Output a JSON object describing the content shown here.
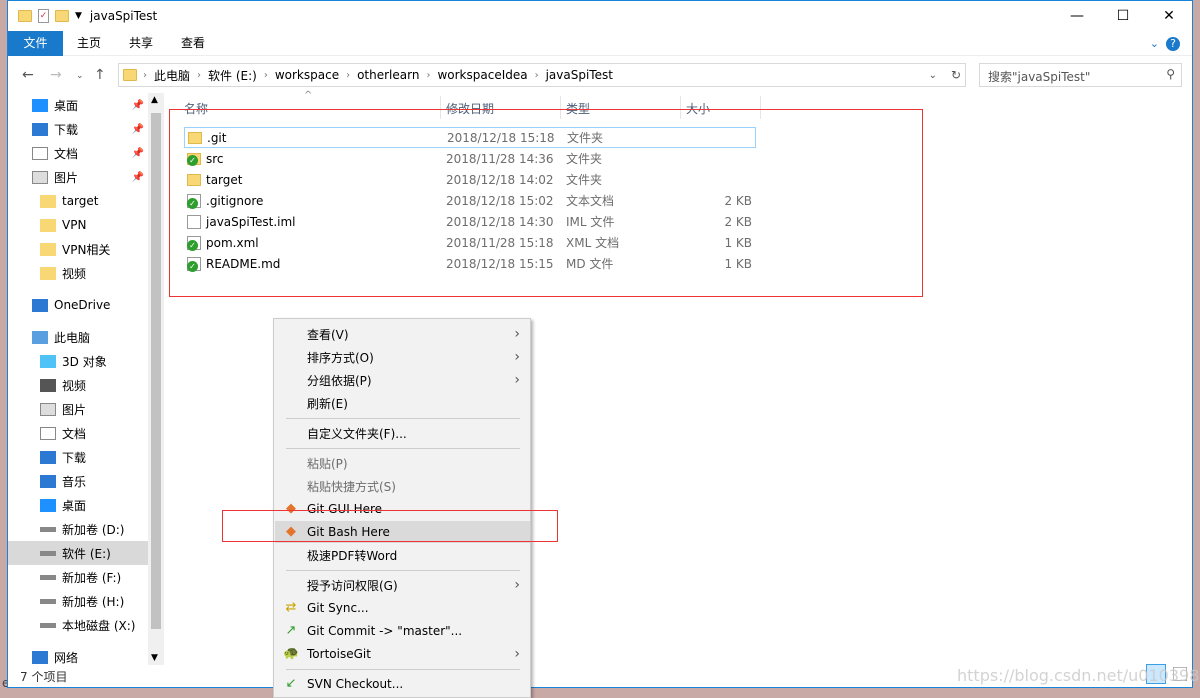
{
  "window": {
    "title": "javaSpiTest",
    "minimize": "—",
    "maximize": "☐",
    "close": "✕"
  },
  "ribbon": {
    "tabs": [
      "文件",
      "主页",
      "共享",
      "查看"
    ],
    "expand": "⌄",
    "help": "?"
  },
  "address": {
    "crumbs": [
      "此电脑",
      "软件 (E:)",
      "workspace",
      "otherlearn",
      "workspaceIdea",
      "javaSpiTest"
    ],
    "search_placeholder": "搜索\"javaSpiTest\""
  },
  "nav": {
    "items": [
      {
        "label": "桌面",
        "icon": "desktop-icon",
        "pinned": true
      },
      {
        "label": "下载",
        "icon": "download-icon",
        "pinned": true
      },
      {
        "label": "文档",
        "icon": "document-icon",
        "pinned": true
      },
      {
        "label": "图片",
        "icon": "picture-icon",
        "pinned": true
      },
      {
        "label": "target",
        "icon": "folder-icon"
      },
      {
        "label": "VPN",
        "icon": "folder-icon"
      },
      {
        "label": "VPN相关",
        "icon": "folder-icon"
      },
      {
        "label": "视频",
        "icon": "folder-icon"
      },
      {
        "label": "OneDrive",
        "icon": "cloud-icon"
      },
      {
        "label": "此电脑",
        "icon": "computer-icon"
      },
      {
        "label": "3D 对象",
        "icon": "cube-icon"
      },
      {
        "label": "视频",
        "icon": "video-icon"
      },
      {
        "label": "图片",
        "icon": "picture-icon"
      },
      {
        "label": "文档",
        "icon": "document-icon"
      },
      {
        "label": "下载",
        "icon": "download-icon"
      },
      {
        "label": "音乐",
        "icon": "music-icon"
      },
      {
        "label": "桌面",
        "icon": "desktop-icon"
      },
      {
        "label": "新加卷 (D:)",
        "icon": "drive-icon"
      },
      {
        "label": "软件 (E:)",
        "icon": "drive-icon",
        "selected": true
      },
      {
        "label": "新加卷 (F:)",
        "icon": "drive-icon"
      },
      {
        "label": "新加卷 (H:)",
        "icon": "drive-icon"
      },
      {
        "label": "本地磁盘 (X:)",
        "icon": "drive-icon"
      },
      {
        "label": "网络",
        "icon": "network-icon"
      }
    ]
  },
  "columns": [
    "名称",
    "修改日期",
    "类型",
    "大小"
  ],
  "files": [
    {
      "name": ".git",
      "date": "2018/12/18 15:18",
      "type": "文件夹",
      "size": "",
      "icon": "folder-icon"
    },
    {
      "name": "src",
      "date": "2018/11/28 14:36",
      "type": "文件夹",
      "size": "",
      "icon": "git-ok-folder-icon"
    },
    {
      "name": "target",
      "date": "2018/12/18 14:02",
      "type": "文件夹",
      "size": "",
      "icon": "folder-icon"
    },
    {
      "name": ".gitignore",
      "date": "2018/12/18 15:02",
      "type": "文本文档",
      "size": "2 KB",
      "icon": "git-ok-file-icon"
    },
    {
      "name": "javaSpiTest.iml",
      "date": "2018/12/18 14:30",
      "type": "IML 文件",
      "size": "2 KB",
      "icon": "file-icon"
    },
    {
      "name": "pom.xml",
      "date": "2018/11/28 15:18",
      "type": "XML 文档",
      "size": "1 KB",
      "icon": "git-ok-file-icon"
    },
    {
      "name": "README.md",
      "date": "2018/12/18 15:15",
      "type": "MD 文件",
      "size": "1 KB",
      "icon": "git-ok-file-icon"
    }
  ],
  "status": {
    "count": "7 个项目"
  },
  "menu": {
    "items": [
      {
        "label": "查看(V)",
        "submenu": true
      },
      {
        "label": "排序方式(O)",
        "submenu": true
      },
      {
        "label": "分组依据(P)",
        "submenu": true
      },
      {
        "label": "刷新(E)"
      },
      {
        "sep": true
      },
      {
        "label": "自定义文件夹(F)..."
      },
      {
        "sep": true
      },
      {
        "label": "粘贴(P)",
        "disabled": true
      },
      {
        "label": "粘贴快捷方式(S)",
        "disabled": true
      },
      {
        "label": "Git GUI Here",
        "icon": "git-icon"
      },
      {
        "label": "Git Bash Here",
        "icon": "git-icon",
        "hover": true
      },
      {
        "label": "极速PDF转Word"
      },
      {
        "sep": true
      },
      {
        "label": "授予访问权限(G)",
        "submenu": true
      },
      {
        "label": "Git Sync...",
        "icon": "git-sync-icon"
      },
      {
        "label": "Git Commit -> \"master\"...",
        "icon": "git-commit-icon"
      },
      {
        "label": "TortoiseGit",
        "icon": "tortoisegit-icon",
        "submenu": true
      },
      {
        "sep": true
      },
      {
        "label": "SVN Checkout...",
        "icon": "svn-checkout-icon"
      }
    ]
  },
  "watermark": "https://blog.csdn.net/u010398138",
  "colors": {
    "accent": "#1979ca",
    "highlight": "#e33333"
  }
}
